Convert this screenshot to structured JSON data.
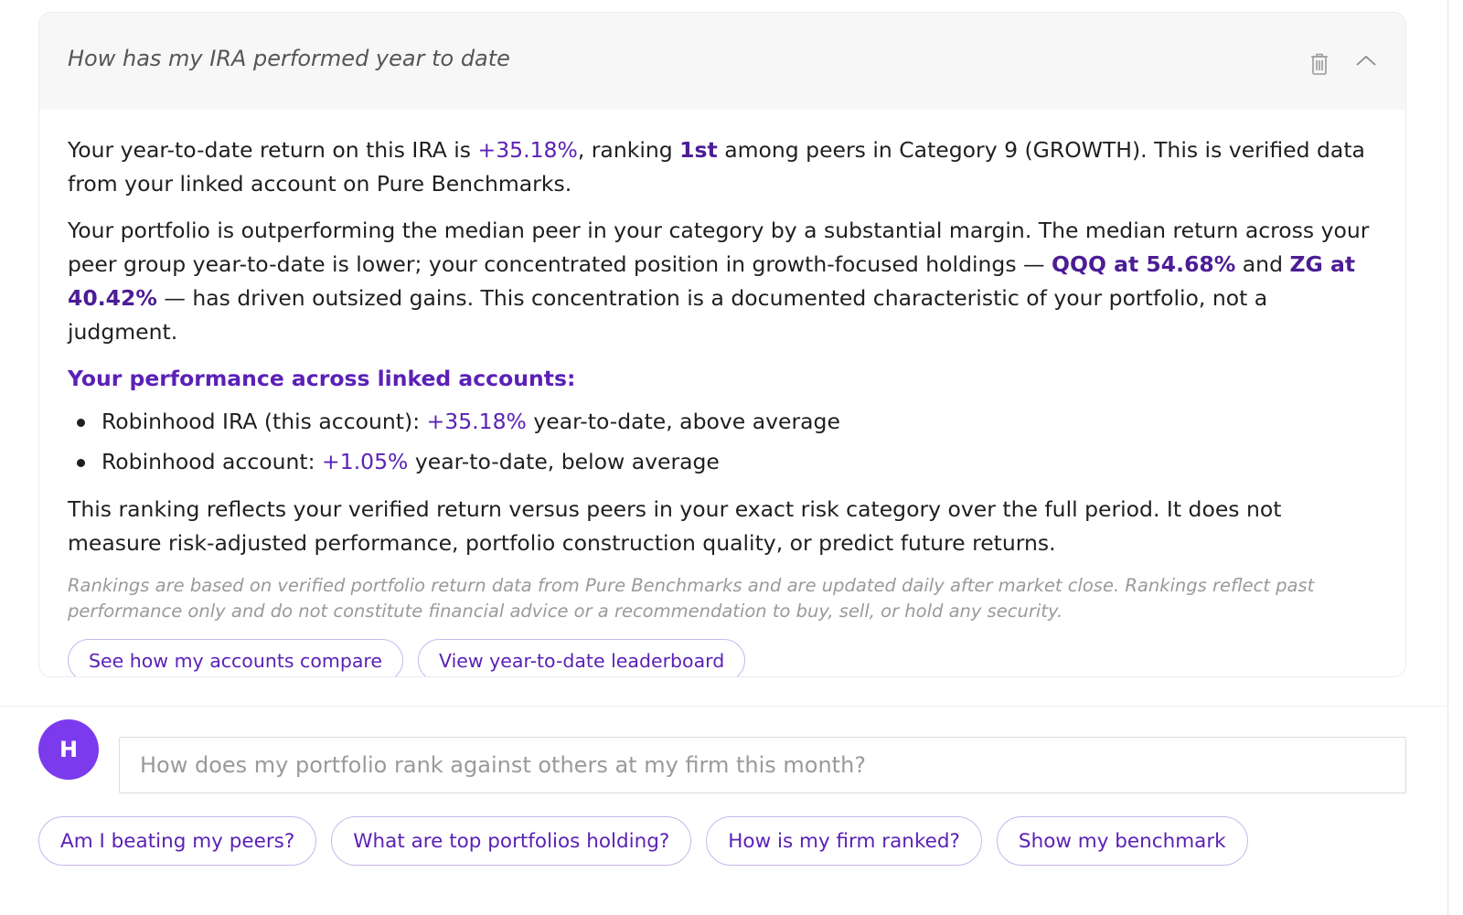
{
  "card": {
    "title": "How has my IRA performed year to date",
    "icons": {
      "delete": "trash-icon",
      "collapse": "chevron-up-icon"
    },
    "paragraph1": {
      "part1": "Your year-to-date return on this IRA is ",
      "return_value": "+35.18%",
      "part2": ", ranking ",
      "rank": "1st",
      "part3": " among peers in Category 9 (GROWTH). This is verified data from your linked account on Pure Benchmarks."
    },
    "paragraph2": {
      "part1": "Your portfolio is outperforming the median peer in your category by a substantial margin. The median return across your peer group year-to-date is lower; your concentrated position in growth-focused holdings — ",
      "holding1": "QQQ at 54.68%",
      "part2": " and ",
      "holding2": "ZG at 40.42%",
      "part3": " — has driven outsized gains. This concentration is a documented characteristic of your portfolio, not a judgment."
    },
    "section_heading": "Your performance across linked accounts:",
    "accounts": [
      {
        "name": "Robinhood IRA (this account): ",
        "value": "+35.18%",
        "note": " year-to-date, above average"
      },
      {
        "name": "Robinhood account: ",
        "value": "+1.05%",
        "note": " year-to-date, below average"
      }
    ],
    "paragraph3": "This ranking reflects your verified return versus peers in your exact risk category over the full period. It does not measure risk-adjusted performance, portfolio construction quality, or predict future returns.",
    "disclaimer": "Rankings are based on verified portfolio return data from Pure Benchmarks and are updated daily after market close. Rankings reflect past performance only and do not constitute financial advice or a recommendation to buy, sell, or hold any security.",
    "actions": [
      "See how my accounts compare",
      "View year-to-date leaderboard"
    ]
  },
  "composer": {
    "avatar_initial": "H",
    "placeholder": "How does my portfolio rank against others at my firm this month?"
  },
  "suggestions": [
    "Am I beating my peers?",
    "What are top portfolios holding?",
    "How is my firm ranked?",
    "Show my benchmark"
  ],
  "colors": {
    "accent": "#5b21b6",
    "avatar": "#7c3aed",
    "pill_border": "#c9b6ec"
  }
}
